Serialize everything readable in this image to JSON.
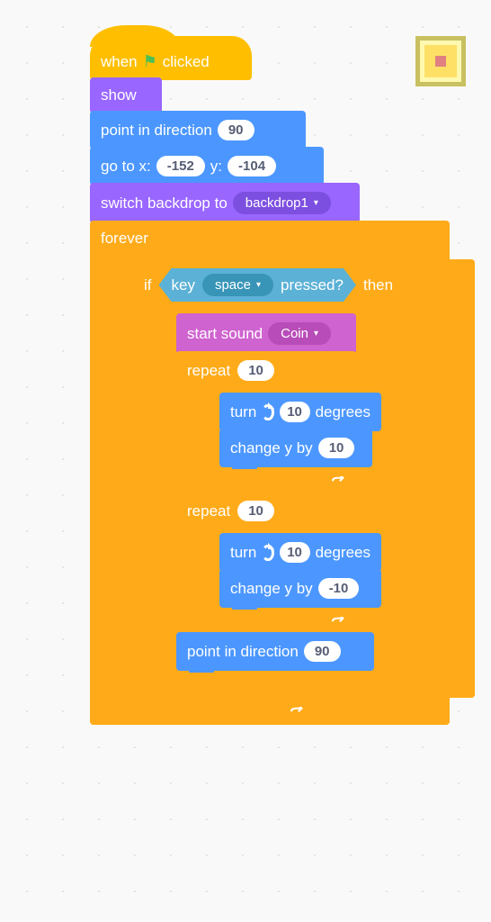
{
  "colors": {
    "events": "#ffbf00",
    "looks": "#9966ff",
    "motion": "#4c97ff",
    "control": "#ffab19",
    "sound": "#cf63cf",
    "sensing": "#5cb1d6"
  },
  "stop_button": {
    "name": "stop"
  },
  "hat": {
    "prefix": "when",
    "suffix": "clicked",
    "icon": "green-flag"
  },
  "show": {
    "label": "show"
  },
  "point_dir1": {
    "prefix": "point in direction",
    "value": "90"
  },
  "goto": {
    "prefix": "go to x:",
    "x": "-152",
    "mid": "y:",
    "y": "-104"
  },
  "switch_backdrop": {
    "prefix": "switch backdrop to",
    "value": "backdrop1"
  },
  "forever": {
    "label": "forever"
  },
  "if": {
    "prefix": "if",
    "suffix": "then"
  },
  "key_pressed": {
    "prefix": "key",
    "key": "space",
    "suffix": "pressed?"
  },
  "start_sound": {
    "prefix": "start sound",
    "value": "Coin"
  },
  "repeat1": {
    "prefix": "repeat",
    "times": "10"
  },
  "turn1": {
    "prefix": "turn",
    "value": "10",
    "suffix": "degrees"
  },
  "changey1": {
    "prefix": "change y by",
    "value": "10"
  },
  "repeat2": {
    "prefix": "repeat",
    "times": "10"
  },
  "turn2": {
    "prefix": "turn",
    "value": "10",
    "suffix": "degrees"
  },
  "changey2": {
    "prefix": "change y by",
    "value": "-10"
  },
  "point_dir2": {
    "prefix": "point in direction",
    "value": "90"
  }
}
